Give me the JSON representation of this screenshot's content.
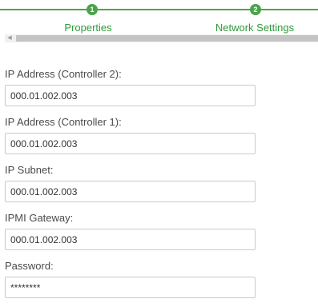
{
  "wizard": {
    "steps": [
      {
        "number": "1",
        "label": "Properties"
      },
      {
        "number": "2",
        "label": "Network Settings"
      }
    ]
  },
  "form": {
    "fields": [
      {
        "label": "IP Address (Controller 2):",
        "value": "000.01.002.003"
      },
      {
        "label": "IP Address (Controller 1):",
        "value": "000.01.002.003"
      },
      {
        "label": "IP Subnet:",
        "value": "000.01.002.003"
      },
      {
        "label": "IPMI Gateway:",
        "value": "000.01.002.003"
      },
      {
        "label": "Password:",
        "value": "********"
      }
    ]
  },
  "colors": {
    "accent": "#4aa44a",
    "step_label": "#2e9a3a"
  }
}
